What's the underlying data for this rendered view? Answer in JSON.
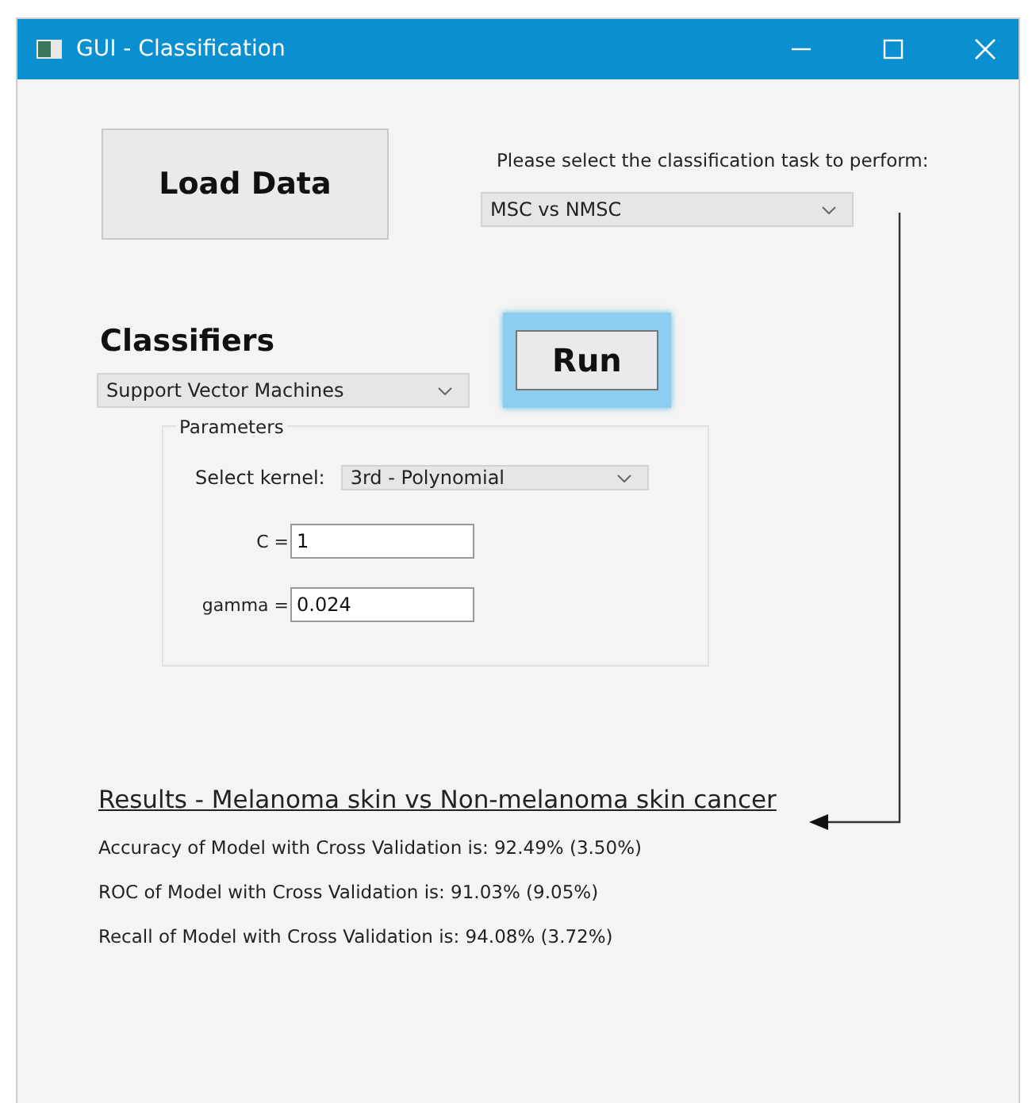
{
  "window": {
    "title": "GUI - Classification"
  },
  "load_button": {
    "label": "Load Data"
  },
  "task": {
    "prompt": "Please select the classification task to perform:",
    "value": "MSC vs NMSC"
  },
  "classifiers": {
    "heading": "Classifiers",
    "value": "Support Vector Machines"
  },
  "run_button": {
    "label": "Run",
    "focused": true
  },
  "parameters": {
    "title": "Parameters",
    "fields": [
      {
        "kind": "select",
        "label": "Select kernel:",
        "value": "3rd - Polynomial"
      },
      {
        "kind": "input",
        "label": "C =",
        "value": "1"
      },
      {
        "kind": "input",
        "label": "gamma =",
        "value": "0.024"
      }
    ]
  },
  "results": {
    "title": "Results - Melanoma skin vs Non-melanoma skin cancer",
    "lines": [
      "Accuracy of Model with Cross Validation is: 92.49% (3.50%)",
      "ROC of Model with Cross Validation is: 91.03% (9.05%)",
      "Recall of Model with Cross Validation is: 94.08% (3.72%)"
    ]
  }
}
